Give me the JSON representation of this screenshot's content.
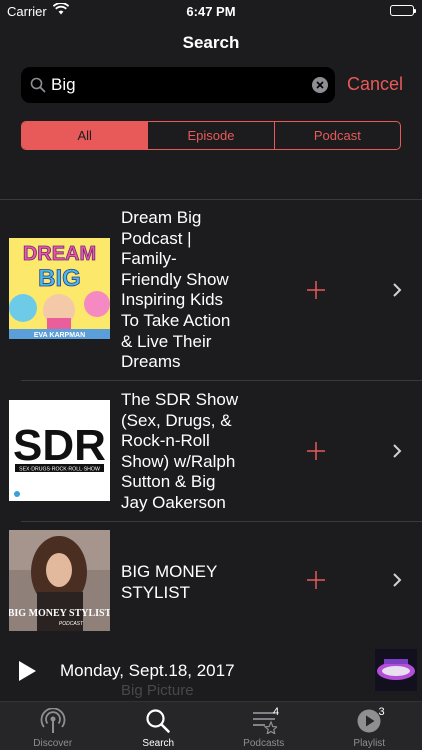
{
  "status_bar": {
    "carrier": "Carrier",
    "time": "6:47 PM"
  },
  "header": {
    "title": "Search"
  },
  "search": {
    "value": "Big",
    "placeholder": "",
    "cancel_label": "Cancel"
  },
  "segments": [
    {
      "label": "All",
      "active": true
    },
    {
      "label": "Episode",
      "active": false
    },
    {
      "label": "Podcast",
      "active": false
    }
  ],
  "results": [
    {
      "title": "Dream Big Podcast | Family-Friendly Show Inspiring Kids To Take Action & Live Their Dreams",
      "title_lines": [
        "Dream Big",
        "Podcast |",
        "Family-",
        "Friendly Show",
        "Inspiring Kids",
        "To Take Action",
        "& Live Their",
        "Dreams"
      ],
      "artwork": {
        "top_text": "DREAM",
        "mid_text": "BIG",
        "footer_text": "EVA KARPMAN"
      }
    },
    {
      "title": "The SDR Show (Sex, Drugs, & Rock-n-Roll Show) w/Ralph Sutton & Big Jay Oakerson",
      "title_lines": [
        "The SDR Show",
        "(Sex, Drugs, &",
        "Rock-n-Roll",
        "Show) w/Ralph",
        "Sutton & Big",
        "Jay Oakerson"
      ],
      "artwork": {
        "logo_text": "SDR",
        "sub_text": "SEX·DRUGS·ROCK·ROLL·SHOW"
      }
    },
    {
      "title": "BIG MONEY STYLIST",
      "title_lines": [
        "BIG MONEY",
        "STYLIST"
      ],
      "artwork": {
        "name_text": "BIG MONEY STYLIST",
        "sub_text": "PODCAST"
      }
    }
  ],
  "now_playing": {
    "title": "Monday, Sept.18, 2017",
    "subtitle": "Big Picture"
  },
  "tabs": [
    {
      "label": "Discover",
      "icon": "discover-icon",
      "badge": "",
      "active": false
    },
    {
      "label": "Search",
      "icon": "search-icon",
      "badge": "",
      "active": true
    },
    {
      "label": "Podcasts",
      "icon": "podcasts-list-icon",
      "badge": "4",
      "active": false
    },
    {
      "label": "Playlist",
      "icon": "playlist-play-icon",
      "badge": "3",
      "active": false
    }
  ],
  "colors": {
    "accent": "#e85a5a",
    "background": "#1c1c1e",
    "search_field": "#000000"
  }
}
